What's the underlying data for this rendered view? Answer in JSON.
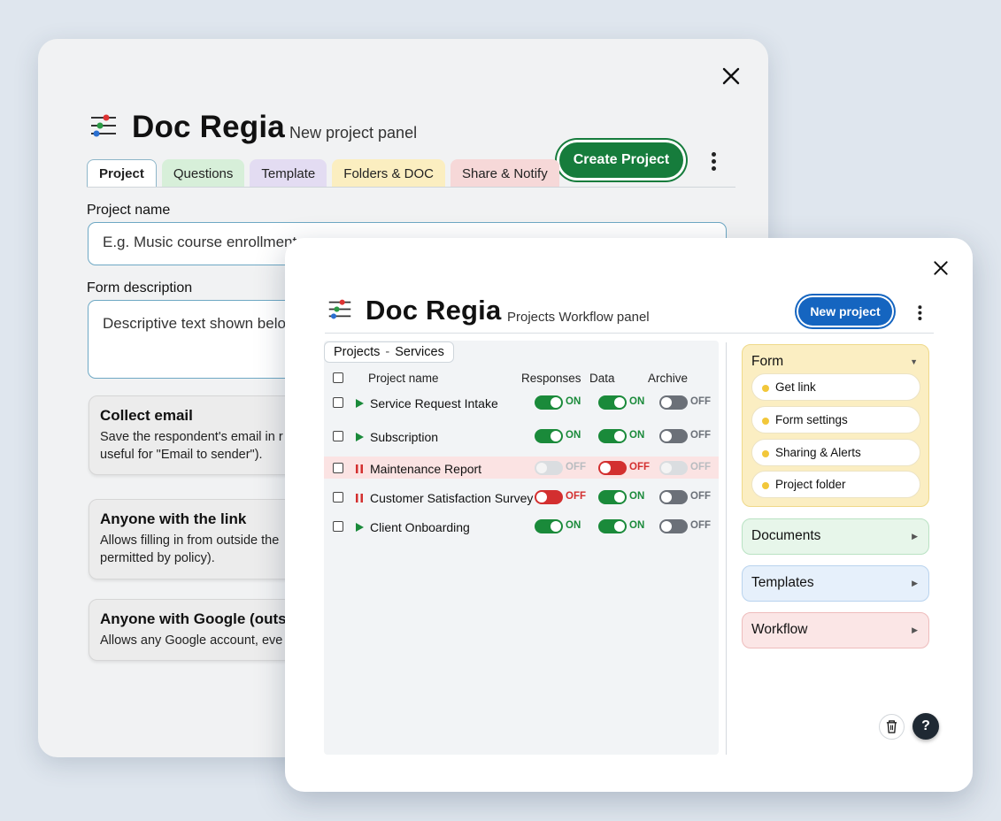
{
  "back_panel": {
    "app_name": "Doc Regia",
    "subtitle": "New project panel",
    "create_button": "Create Project",
    "tabs": [
      {
        "label": "Project",
        "color": "#ffffff"
      },
      {
        "label": "Questions",
        "color": "#d7efd9"
      },
      {
        "label": "Template",
        "color": "#e3dcf2"
      },
      {
        "label": "Folders & DOC",
        "color": "#fbeec0"
      },
      {
        "label": "Share & Notify",
        "color": "#f6d8d8"
      }
    ],
    "project_name_label": "Project name",
    "project_name_placeholder": "E.g. Music course enrollment",
    "form_description_label": "Form description",
    "form_description_placeholder": "Descriptive text shown below",
    "options": [
      {
        "title": "Collect email",
        "desc_lines": [
          "Save the respondent's email in r",
          "useful for \"Email to sender\")."
        ]
      },
      {
        "title": "Anyone with the link",
        "desc_lines": [
          "Allows filling in from outside the",
          "permitted by policy)."
        ]
      },
      {
        "title": "Anyone with Google (outsic",
        "desc_lines": [
          "Allows any Google account, eve"
        ]
      }
    ]
  },
  "front_panel": {
    "app_name": "Doc Regia",
    "subtitle": "Projects Workflow panel",
    "new_button": "New project",
    "breadcrumb": {
      "root": "Projects",
      "sep": "-",
      "current": "Services"
    },
    "columns": {
      "name": "Project name",
      "responses": "Responses",
      "data": "Data",
      "archive": "Archive"
    },
    "rows": [
      {
        "name": "Service Request Intake",
        "status": "play",
        "highlight": false,
        "responses": {
          "state": "on",
          "text": "ON"
        },
        "data": {
          "state": "on",
          "text": "ON"
        },
        "archive": {
          "state": "off",
          "text": "OFF"
        }
      },
      {
        "name": "Subscription",
        "status": "play",
        "highlight": false,
        "responses": {
          "state": "on",
          "text": "ON"
        },
        "data": {
          "state": "on",
          "text": "ON"
        },
        "archive": {
          "state": "off",
          "text": "OFF"
        }
      },
      {
        "name": "Maintenance Report",
        "status": "pause",
        "highlight": true,
        "responses": {
          "state": "disabled",
          "text": "OFF"
        },
        "data": {
          "state": "red",
          "text": "OFF"
        },
        "archive": {
          "state": "disabled",
          "text": "OFF"
        }
      },
      {
        "name": "Customer Satisfaction Survey",
        "status": "pause",
        "highlight": false,
        "responses": {
          "state": "red",
          "text": "OFF"
        },
        "data": {
          "state": "on",
          "text": "ON"
        },
        "archive": {
          "state": "off",
          "text": "OFF"
        }
      },
      {
        "name": "Client Onboarding",
        "status": "play",
        "highlight": false,
        "responses": {
          "state": "on",
          "text": "ON"
        },
        "data": {
          "state": "on",
          "text": "ON"
        },
        "archive": {
          "state": "off",
          "text": "OFF"
        }
      }
    ],
    "form_section": {
      "title": "Form",
      "items": [
        "Get link",
        "Form settings",
        "Sharing & Alerts",
        "Project folder"
      ]
    },
    "sections": [
      {
        "title": "Documents"
      },
      {
        "title": "Templates"
      },
      {
        "title": "Workflow"
      }
    ],
    "help_label": "?"
  },
  "colors": {
    "green": "#167c3c",
    "blue": "#1565c0",
    "toggle_on": "#1a8a3a",
    "toggle_red": "#d32f2f"
  }
}
